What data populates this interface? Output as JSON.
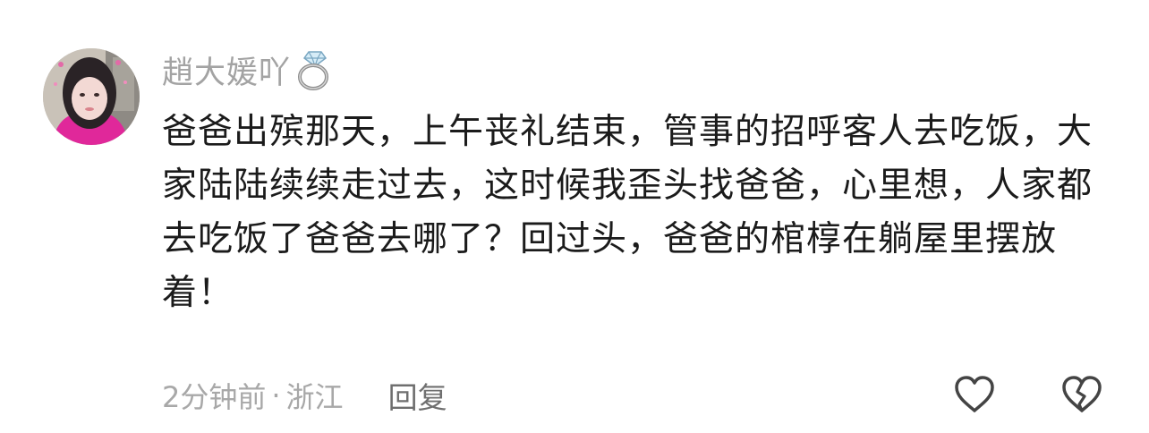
{
  "comment": {
    "username": "趙大媛吖",
    "username_badge_icon": "ring-icon",
    "text": "爸爸出殡那天，上午丧礼结束，管事的招呼客人去吃饭，大家陆陆续续走过去，这时候我歪头找爸爸，心里想，人家都去吃饭了爸爸去哪了？回过头，爸爸的棺椁在躺屋里摆放着！",
    "time": "2分钟前",
    "separator": "·",
    "region": "浙江",
    "reply_label": "回复",
    "like_icon": "heart-outline-icon",
    "dislike_icon": "broken-heart-outline-icon"
  },
  "colors": {
    "username": "#a3a3a3",
    "text": "#1b1b1b",
    "meta": "#a8a8a8",
    "reply": "#6f6f6f",
    "icon": "#444444"
  }
}
